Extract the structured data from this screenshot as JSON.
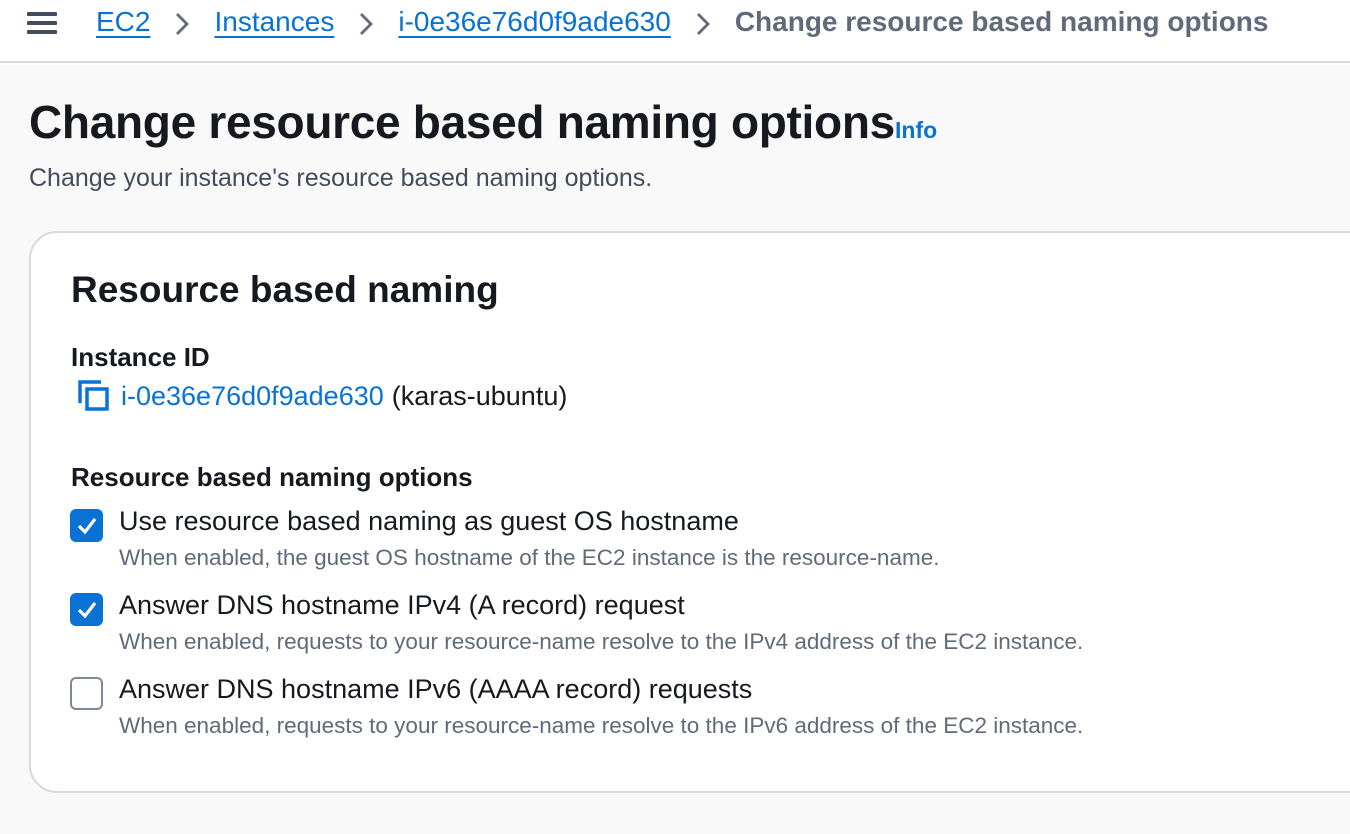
{
  "breadcrumb": {
    "items": [
      {
        "label": "EC2"
      },
      {
        "label": "Instances"
      },
      {
        "label": "i-0e36e76d0f9ade630"
      }
    ],
    "current": "Change resource based naming options"
  },
  "page": {
    "title": "Change resource based naming options",
    "info_link": "Info",
    "description": "Change your instance's resource based naming options."
  },
  "panel": {
    "title": "Resource based naming",
    "instance_id_label": "Instance ID",
    "instance_id": "i-0e36e76d0f9ade630",
    "instance_name": "(karas-ubuntu)",
    "options_label": "Resource based naming options",
    "options": [
      {
        "label": "Use resource based naming as guest OS hostname",
        "description": "When enabled, the guest OS hostname of the EC2 instance is the resource-name.",
        "checked": true
      },
      {
        "label": "Answer DNS hostname IPv4 (A record) request",
        "description": "When enabled, requests to your resource-name resolve to the IPv4 address of the EC2 instance.",
        "checked": true
      },
      {
        "label": "Answer DNS hostname IPv6 (AAAA record) requests",
        "description": "When enabled, requests to your resource-name resolve to the IPv6 address of the EC2 instance.",
        "checked": false
      }
    ]
  },
  "colors": {
    "link": "#0972d3",
    "checkbox_checked": "#0972d3",
    "text": "#16191f",
    "secondary_text": "#5f6b7a"
  },
  "icons": {
    "menu": "hamburger-menu-icon",
    "separator": "chevron-right-icon",
    "copy": "copy-icon",
    "check": "checkmark-icon"
  }
}
